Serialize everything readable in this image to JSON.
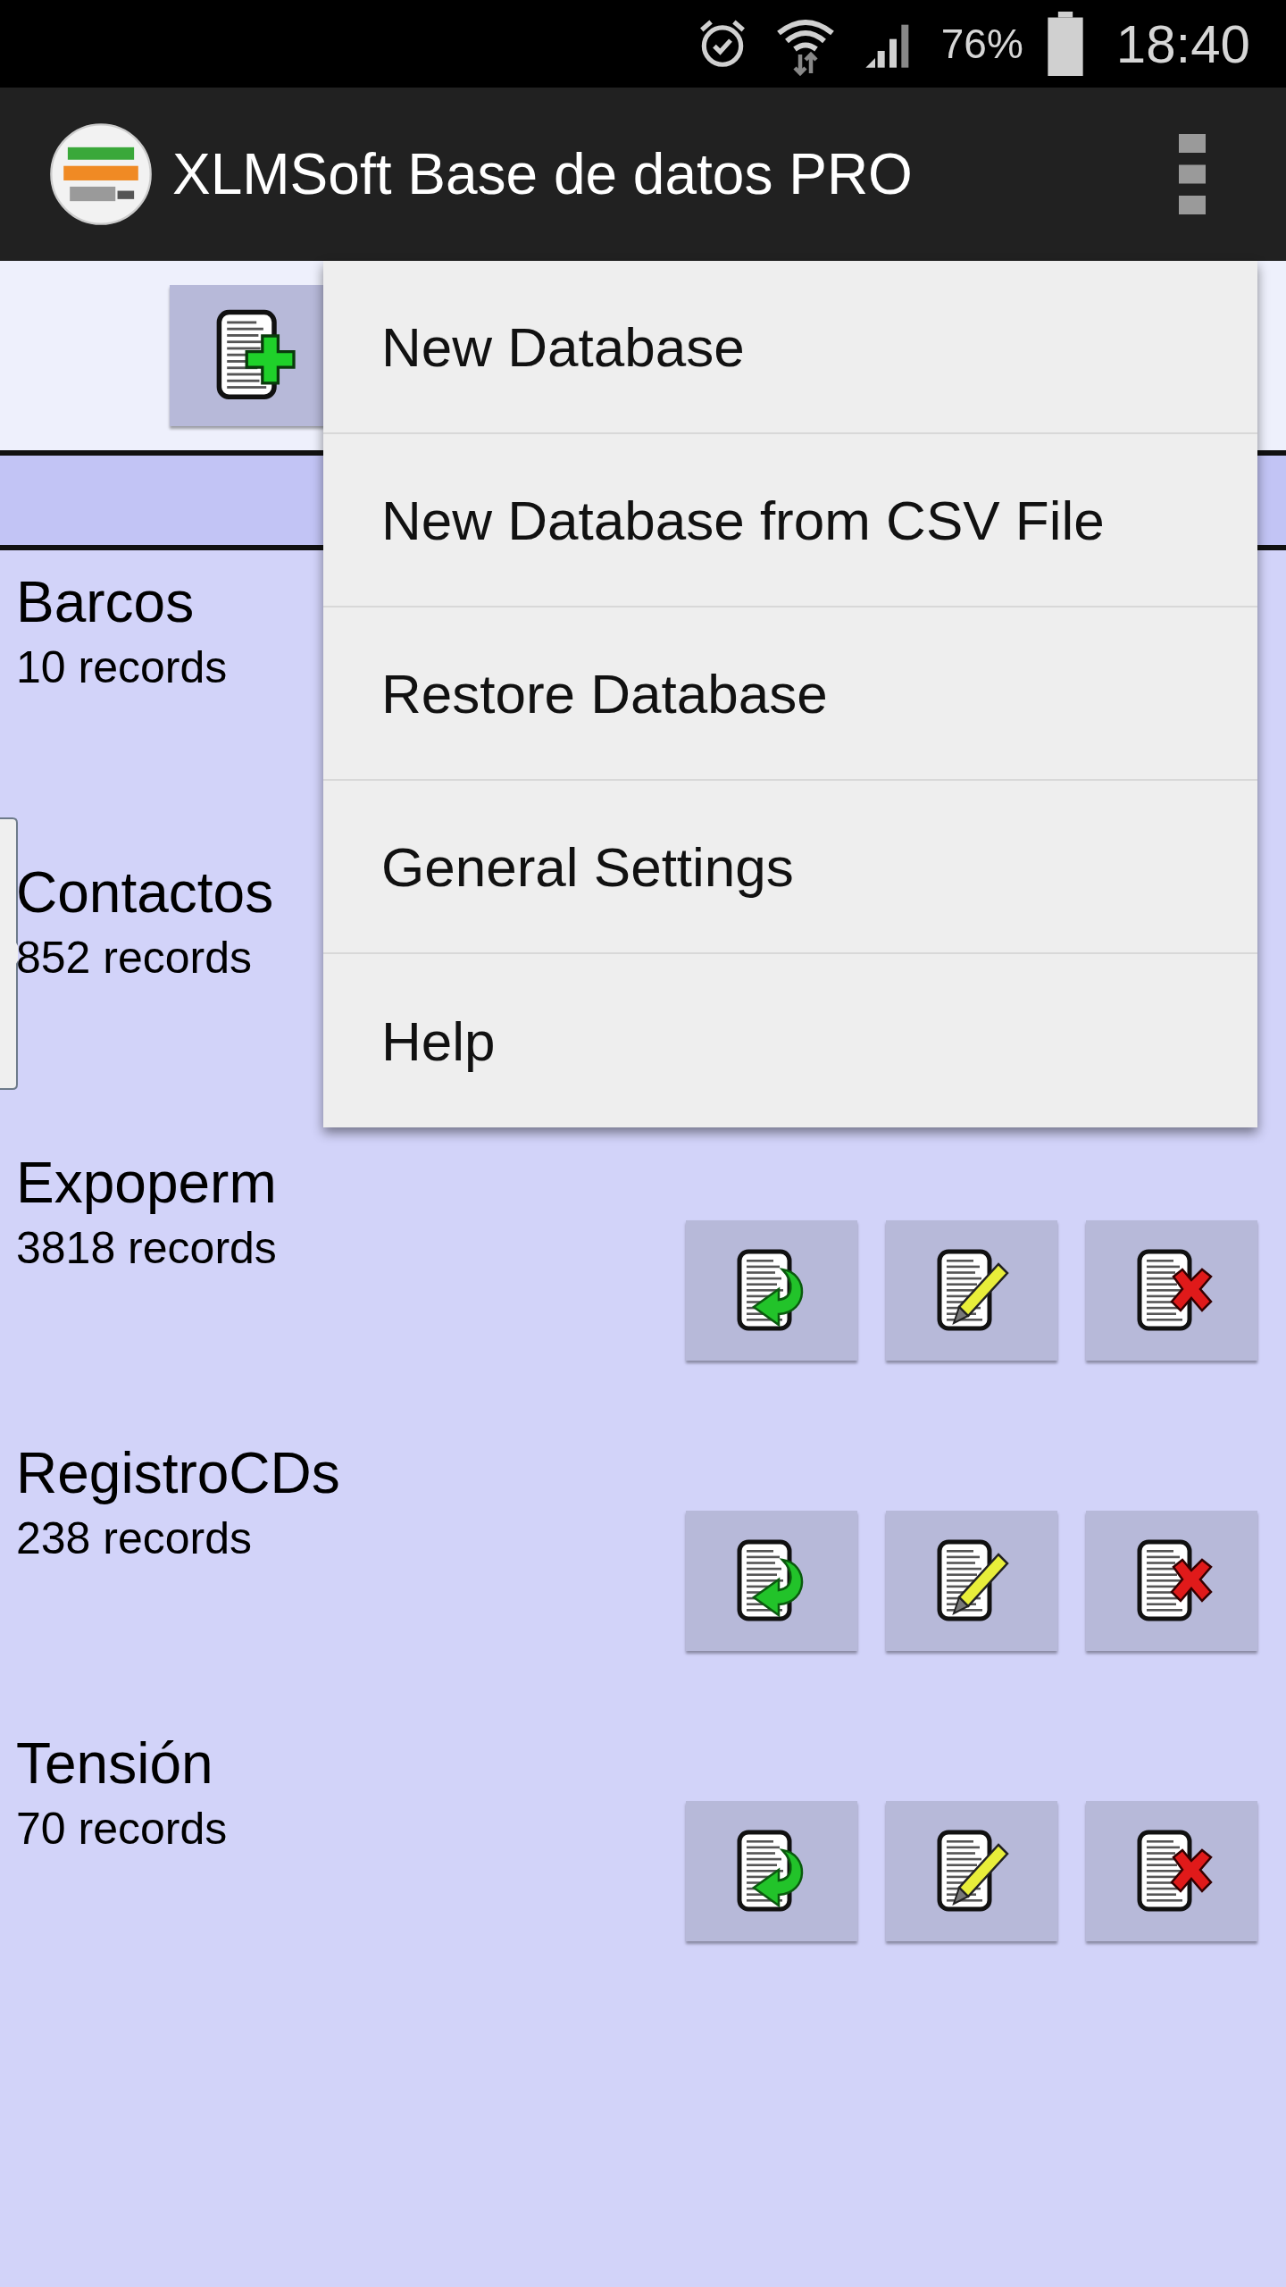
{
  "status_bar": {
    "battery": "76%",
    "time": "18:40"
  },
  "app_bar": {
    "title": "XLMSoft Base de datos PRO"
  },
  "databases": [
    {
      "name": "Barcos",
      "count": "10 records"
    },
    {
      "name": "Contactos",
      "count": "852 records"
    },
    {
      "name": "Expoperm",
      "count": "3818 records",
      "actions": [
        {
          "kind": "open"
        },
        {
          "kind": "edit"
        },
        {
          "kind": "delete"
        }
      ]
    },
    {
      "name": "RegistroCDs",
      "count": "238 records",
      "actions": [
        {
          "kind": "open"
        },
        {
          "kind": "edit"
        },
        {
          "kind": "delete"
        }
      ]
    },
    {
      "name": "Tensión",
      "count": "70 records",
      "actions": [
        {
          "kind": "open"
        },
        {
          "kind": "edit"
        },
        {
          "kind": "delete"
        }
      ]
    }
  ],
  "overflow_menu": {
    "items": [
      "New Database",
      "New Database from CSV File",
      "Restore Database",
      "General Settings",
      "Help"
    ]
  }
}
